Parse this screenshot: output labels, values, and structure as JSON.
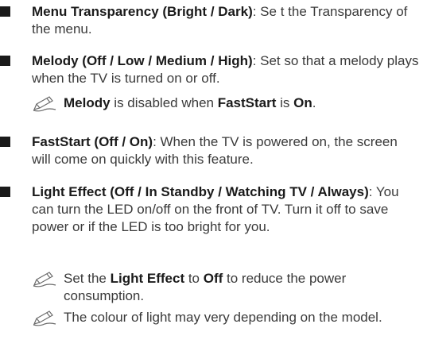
{
  "items": [
    {
      "term": "Menu Transparency (Bright / Dark)",
      "desc": ": Se t the Transparency of the menu."
    },
    {
      "term": "Melody (Off / Low / Medium / High)",
      "desc": ": Set so that a melody plays when the TV is turned on or off.",
      "notes": [
        {
          "parts": [
            "Melody",
            " is disabled when ",
            "FastStart",
            " is ",
            "On",
            "."
          ]
        }
      ]
    },
    {
      "term": "FastStart (Off / On)",
      "desc": ": When the TV is powered on, the screen will come on quickly with this feature."
    },
    {
      "term": "Light Effect (Off / In Standby / Watching TV / Always)",
      "desc": ": You can turn the LED on/off on the front of TV. Turn it off to save power or if the LED is too bright for you.",
      "notes": [
        {
          "parts": [
            "Set the ",
            "Light Effect",
            " to ",
            "Off",
            " to reduce the power consumption."
          ]
        },
        {
          "parts": [
            "The colour of light may very depending on the model."
          ]
        }
      ]
    }
  ],
  "icons": {
    "note": "pencil-note-icon",
    "bullet": "square-bullet-icon"
  },
  "colors": {
    "text": "#3a3a3a",
    "bold": "#1a1a1a",
    "bullet": "#1a1a1a",
    "icon": "#6a6a6a"
  }
}
